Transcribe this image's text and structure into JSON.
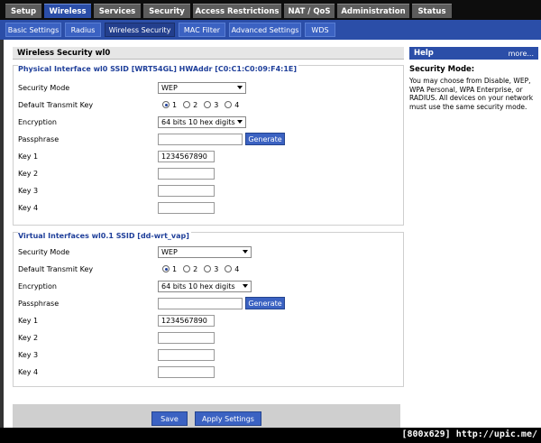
{
  "top_tabs": [
    {
      "label": "Setup"
    },
    {
      "label": "Wireless"
    },
    {
      "label": "Services"
    },
    {
      "label": "Security"
    },
    {
      "label": "Access Restrictions"
    },
    {
      "label": "NAT / QoS"
    },
    {
      "label": "Administration"
    },
    {
      "label": "Status"
    }
  ],
  "sub_tabs": [
    {
      "label": "Basic Settings"
    },
    {
      "label": "Radius"
    },
    {
      "label": "Wireless Security"
    },
    {
      "label": "MAC Filter"
    },
    {
      "label": "Advanced Settings"
    },
    {
      "label": "WDS"
    }
  ],
  "section_title": "Wireless Security wl0",
  "physical": {
    "legend": "Physical Interface wl0 SSID [WRT54GL] HWAddr [C0:C1:C0:09:F4:1E]",
    "security_mode_label": "Security Mode",
    "security_mode_value": "WEP",
    "transmit_key_label": "Default Transmit Key",
    "transmit_key_options": [
      "1",
      "2",
      "3",
      "4"
    ],
    "transmit_key_selected": "1",
    "encryption_label": "Encryption",
    "encryption_value": "64 bits 10 hex digits",
    "passphrase_label": "Passphrase",
    "passphrase_value": "",
    "generate_label": "Generate",
    "key1_label": "Key 1",
    "key1_value": "1234567890",
    "key2_label": "Key 2",
    "key2_value": "",
    "key3_label": "Key 3",
    "key3_value": "",
    "key4_label": "Key 4",
    "key4_value": ""
  },
  "virtual": {
    "legend": "Virtual Interfaces wl0.1 SSID [dd-wrt_vap]",
    "security_mode_label": "Security Mode",
    "security_mode_value": "WEP",
    "transmit_key_label": "Default Transmit Key",
    "transmit_key_options": [
      "1",
      "2",
      "3",
      "4"
    ],
    "transmit_key_selected": "1",
    "encryption_label": "Encryption",
    "encryption_value": "64 bits 10 hex digits",
    "passphrase_label": "Passphrase",
    "passphrase_value": "",
    "generate_label": "Generate",
    "key1_label": "Key 1",
    "key1_value": "1234567890",
    "key2_label": "Key 2",
    "key2_value": "",
    "key3_label": "Key 3",
    "key3_value": "",
    "key4_label": "Key 4",
    "key4_value": ""
  },
  "help": {
    "title": "Help",
    "more": "more...",
    "heading": "Security Mode:",
    "text": "You may choose from Disable, WEP, WPA Personal, WPA Enterprise, or RADIUS. All devices on your network must use the same security mode."
  },
  "footer": {
    "save_label": "Save",
    "apply_label": "Apply Settings"
  },
  "watermark": "[800x629] http://upic.me/",
  "colors": {
    "accent": "#2b4ea8",
    "legend": "#1f3f9a"
  }
}
